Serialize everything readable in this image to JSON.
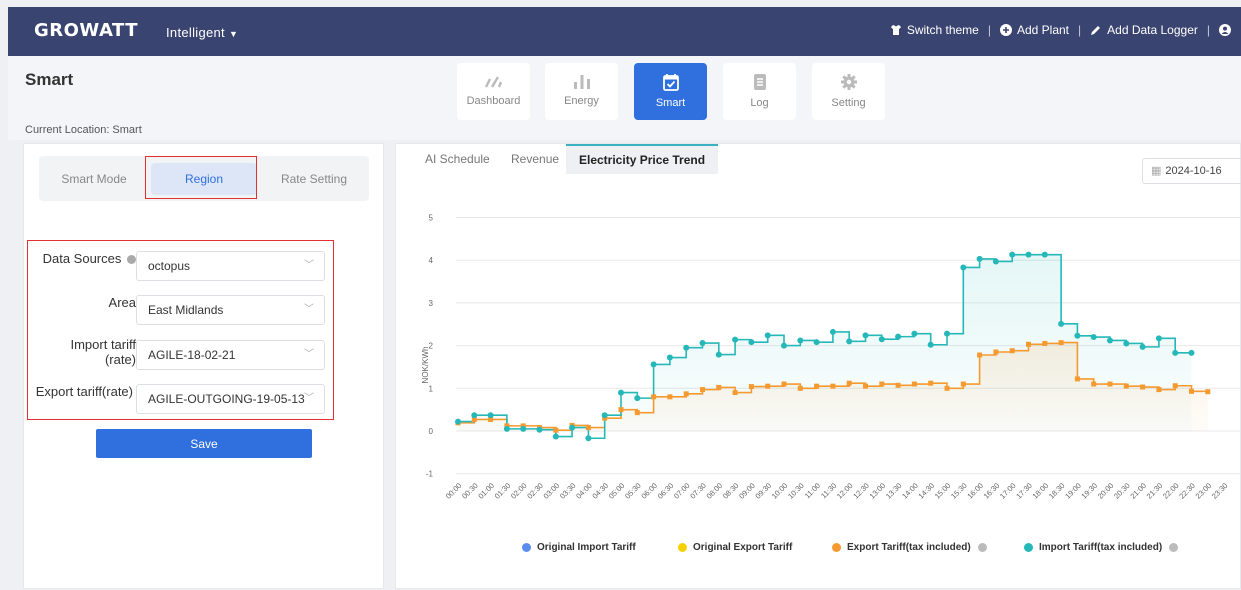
{
  "topbar": {
    "logo": "GROWATT",
    "app_name": "Intelligent",
    "actions": [
      {
        "label": "Switch theme",
        "icon": "shirt-icon"
      },
      {
        "label": "Add Plant",
        "icon": "plus-circle-icon"
      },
      {
        "label": "Add Data Logger",
        "icon": "pen-icon"
      }
    ]
  },
  "page": {
    "title": "Smart",
    "breadcrumb": "Current Location: Smart"
  },
  "nav": [
    {
      "label": "Dashboard",
      "icon": "gauge-icon",
      "active": false
    },
    {
      "label": "Energy",
      "icon": "bar-chart-icon",
      "active": false
    },
    {
      "label": "Smart",
      "icon": "calendar-check-icon",
      "active": true
    },
    {
      "label": "Log",
      "icon": "document-icon",
      "active": false
    },
    {
      "label": "Setting",
      "icon": "gear-icon",
      "active": false
    }
  ],
  "smart_tabs": [
    "Smart Mode",
    "Region",
    "Rate Setting"
  ],
  "form": {
    "data_sources": {
      "label": "Data Sources",
      "value": "octopus"
    },
    "area": {
      "label": "Area",
      "value": "East Midlands"
    },
    "import_tariff": {
      "label_line1": "Import tariff",
      "label_line2": "(rate)",
      "value": "AGILE-18-02-21"
    },
    "export_tariff": {
      "label": "Export tariff(rate)",
      "value": "AGILE-OUTGOING-19-05-13"
    },
    "save_label": "Save"
  },
  "chart_tabs": [
    "AI Schedule",
    "Revenue",
    "Electricity Price Trend"
  ],
  "date_value": "2024-10-16",
  "chart_data": {
    "type": "line",
    "ylabel": "NOK/KWh",
    "ylim": [
      -1,
      5
    ],
    "yticks": [
      -1,
      0,
      1,
      2,
      3,
      4,
      5
    ],
    "x": [
      "00:00",
      "00:30",
      "01:00",
      "01:30",
      "02:00",
      "02:30",
      "03:00",
      "03:30",
      "04:00",
      "04:30",
      "05:00",
      "05:30",
      "06:00",
      "06:30",
      "07:00",
      "07:30",
      "08:00",
      "08:30",
      "09:00",
      "09:30",
      "10:00",
      "10:30",
      "11:00",
      "11:30",
      "12:00",
      "12:30",
      "13:00",
      "13:30",
      "14:00",
      "14:30",
      "15:00",
      "15:30",
      "16:00",
      "16:30",
      "17:00",
      "17:30",
      "18:00",
      "18:30",
      "19:00",
      "19:30",
      "20:00",
      "20:30",
      "21:00",
      "21:30",
      "22:00",
      "22:30",
      "23:00",
      "23:30"
    ],
    "series": [
      {
        "name": "Original Import Tariff",
        "color": "#5b8def",
        "values": []
      },
      {
        "name": "Original Export Tariff",
        "color": "#f7d000",
        "values": []
      },
      {
        "name": "Export Tariff(tax included)",
        "color": "#f59a30",
        "values": [
          0.19,
          0.27,
          0.27,
          0.12,
          0.12,
          0.08,
          0.02,
          0.13,
          0.08,
          0.3,
          0.5,
          0.43,
          0.8,
          0.8,
          0.87,
          0.97,
          1.02,
          0.9,
          1.04,
          1.05,
          1.1,
          1.0,
          1.05,
          1.05,
          1.12,
          1.05,
          1.1,
          1.07,
          1.1,
          1.12,
          1.0,
          1.1,
          1.78,
          1.85,
          1.88,
          2.03,
          2.05,
          2.07,
          1.22,
          1.1,
          1.1,
          1.05,
          1.03,
          0.97,
          1.06,
          0.93,
          0.92
        ]
      },
      {
        "name": "Import Tariff(tax included)",
        "color": "#26b8b8",
        "values": [
          0.22,
          0.37,
          0.37,
          0.05,
          0.05,
          0.03,
          -0.13,
          0.08,
          -0.17,
          0.37,
          0.9,
          0.77,
          1.56,
          1.72,
          1.95,
          2.06,
          1.79,
          2.14,
          2.08,
          2.24,
          2.0,
          2.12,
          2.08,
          2.32,
          2.1,
          2.24,
          2.15,
          2.21,
          2.28,
          2.02,
          2.28,
          3.83,
          4.03,
          3.97,
          4.13,
          4.13,
          4.13,
          2.51,
          2.23,
          2.2,
          2.12,
          2.05,
          1.97,
          2.17,
          1.83,
          1.83
        ]
      }
    ],
    "legend_position": "bottom"
  }
}
